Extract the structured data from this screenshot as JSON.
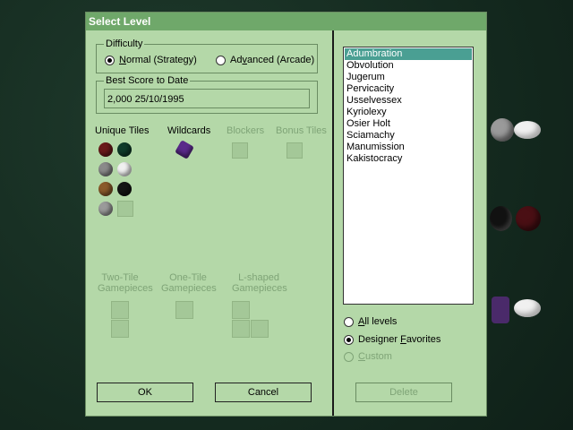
{
  "dialog": {
    "title": "Select Level",
    "difficulty": {
      "label": "Difficulty",
      "options": [
        {
          "prefix": "",
          "access": "N",
          "rest": "ormal (Strategy)",
          "selected": true
        },
        {
          "prefix": "Ad",
          "access": "v",
          "rest": "anced (Arcade)",
          "selected": false
        }
      ]
    },
    "best_score": {
      "label": "Best Score to Date",
      "value": "2,000  25/10/1995"
    },
    "tile_sections": {
      "unique": "Unique Tiles",
      "wildcards": "Wildcards",
      "blockers": "Blockers",
      "bonus": "Bonus Tiles"
    },
    "gamepieces": {
      "two_tile": [
        "Two-Tile",
        "Gamepieces"
      ],
      "one_tile": [
        "One-Tile",
        "Gamepieces"
      ],
      "l_shaped": [
        "L-shaped",
        "Gamepieces"
      ]
    },
    "buttons": {
      "ok": "OK",
      "cancel": "Cancel",
      "delete": "Delete"
    },
    "levels": [
      "Adumbration",
      "Obvolution",
      "Jugerum",
      "Pervicacity",
      "Usselvessex",
      "Kyriolexy",
      "Osier Holt",
      "Sciamachy",
      "Manumission",
      "Kakistocracy"
    ],
    "selected_level": "Adumbration",
    "filter": {
      "all_levels": {
        "access": "A",
        "rest": "ll levels"
      },
      "designer_favorites": {
        "prefix": "Designer ",
        "access": "F",
        "rest": "avorites"
      },
      "custom": {
        "access": "C",
        "rest": "ustom"
      },
      "selected": "designer_favorites"
    }
  },
  "colors": {
    "dialog_bg": "#b4d8a8",
    "title_bg": "#6fa86a",
    "selection": "#4a9f93",
    "disabled_text": "#7fa477"
  }
}
